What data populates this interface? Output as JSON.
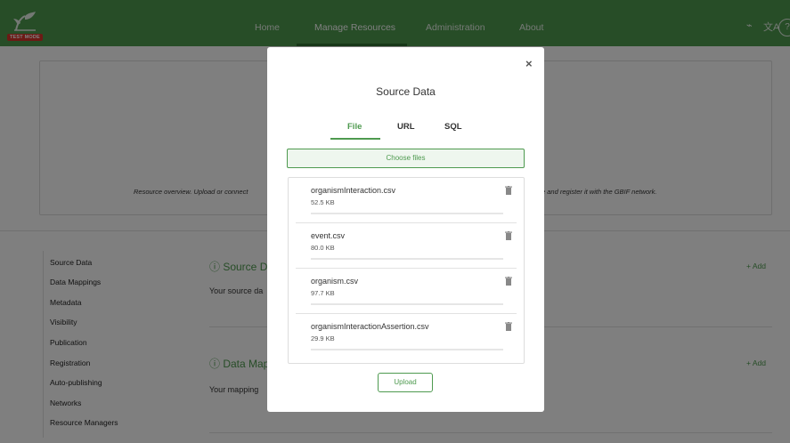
{
  "header": {
    "test_badge": "TEST MODE",
    "nav": [
      "Home",
      "Manage Resources",
      "Administration",
      "About"
    ],
    "active_nav": "Manage Resources"
  },
  "background": {
    "overview_text_left": "Resource overview. Upload or connect",
    "overview_text_right": "e and register it with the GBIF network.",
    "sidebar": [
      "Source Data",
      "Data Mappings",
      "Metadata",
      "Visibility",
      "Publication",
      "Registration",
      "Auto-publishing",
      "Networks",
      "Resource Managers"
    ],
    "sections": [
      {
        "title": "ⓘ Source D",
        "text": "Your source da",
        "add": "+ Add"
      },
      {
        "title": "ⓘ Data Map",
        "text": "Your mapping",
        "add": "+ Add"
      }
    ]
  },
  "modal": {
    "close": "×",
    "title": "Source Data",
    "tabs": [
      "File",
      "URL",
      "SQL"
    ],
    "active_tab": "File",
    "choose_label": "Choose files",
    "files": [
      {
        "name": "organismInteraction.csv",
        "size": "52.5 KB",
        "progress": 0
      },
      {
        "name": "event.csv",
        "size": "80.0 KB",
        "progress": 0
      },
      {
        "name": "organism.csv",
        "size": "97.7 KB",
        "progress": 0
      },
      {
        "name": "organismInteractionAssertion.csv",
        "size": "29.9 KB",
        "progress": 0
      }
    ],
    "upload_label": "Upload"
  }
}
